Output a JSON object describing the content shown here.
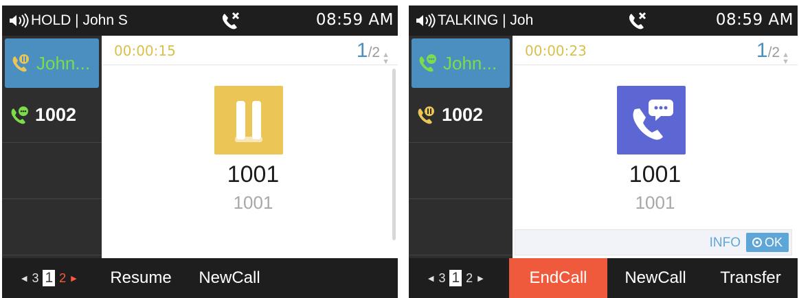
{
  "screens": [
    {
      "status": {
        "text": "HOLD | John S",
        "time": "08:59 AM"
      },
      "lines": [
        {
          "label": "John...",
          "state": "hold"
        },
        {
          "label": "1002",
          "state": "active"
        }
      ],
      "timer": "00:00:15",
      "pager": {
        "current": "1",
        "total": "/2"
      },
      "callee": {
        "name": "1001",
        "number": "1001"
      },
      "pages": [
        "3",
        "1",
        "2"
      ],
      "softkeys": [
        "Resume",
        "NewCall"
      ]
    },
    {
      "status": {
        "text": "TALKING | Joh",
        "time": "08:59 AM"
      },
      "lines": [
        {
          "label": "John...",
          "state": "active"
        },
        {
          "label": "1002",
          "state": "hold"
        }
      ],
      "timer": "00:00:23",
      "pager": {
        "current": "1",
        "total": "/2"
      },
      "callee": {
        "name": "1001",
        "number": "1001"
      },
      "info": {
        "label": "INFO",
        "ok": "OK"
      },
      "pages": [
        "3",
        "1",
        "2"
      ],
      "softkeys": [
        "EndCall",
        "NewCall",
        "Transfer"
      ]
    }
  ],
  "colors": {
    "hold_avatar": "#ebc555",
    "talk_avatar": "#5c67d4",
    "selected_line": "#4a8fc0",
    "end_call": "#f05a3c",
    "timer": "#d9c04a",
    "line_green": "#7cdc4a"
  },
  "icons": {
    "status_mid": "call-forward-cancel-icon",
    "speaker": "speaker-icon",
    "hold_avatar": "pause-icon",
    "talk_avatar": "phone-chat-icon"
  }
}
